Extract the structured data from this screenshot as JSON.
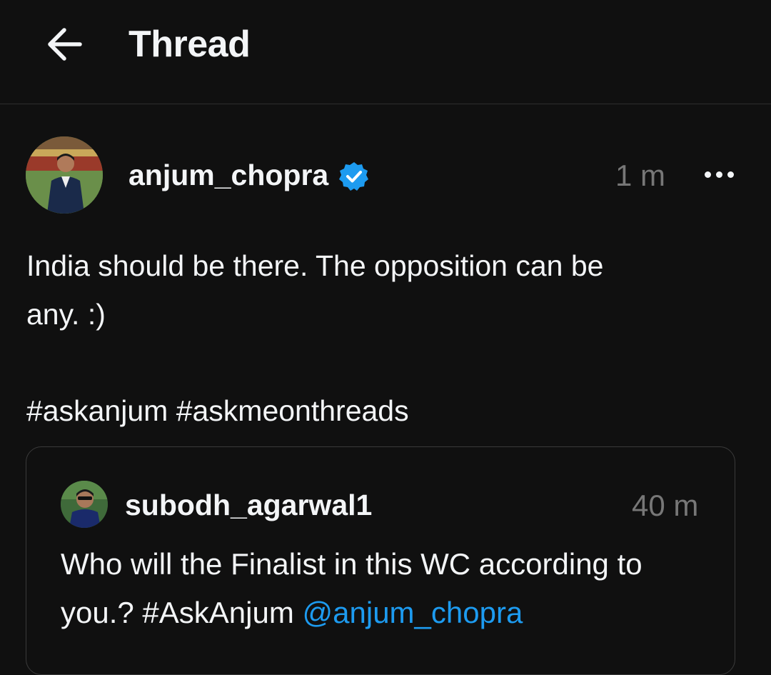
{
  "header": {
    "title": "Thread"
  },
  "post": {
    "username": "anjum_chopra",
    "time": "1 m",
    "text_lines": [
      "India should be there. The opposition can be",
      "any. :)"
    ],
    "hashtags": [
      "#askanjum",
      "#askmeonthreads"
    ]
  },
  "quoted": {
    "username": "subodh_agarwal1",
    "time": "40 m",
    "line1": "Who will the Finalist in this WC according to",
    "line2_prefix": "you.? #AskAnjum ",
    "mention": "@anjum_chopra"
  },
  "colors": {
    "background": "#101010",
    "text": "#f3f5f7",
    "muted": "#777777",
    "link": "#1d9bf0",
    "verified": "#1d9bf0"
  },
  "icons": [
    "back-arrow-icon",
    "verified-badge-icon",
    "more-options-icon"
  ]
}
